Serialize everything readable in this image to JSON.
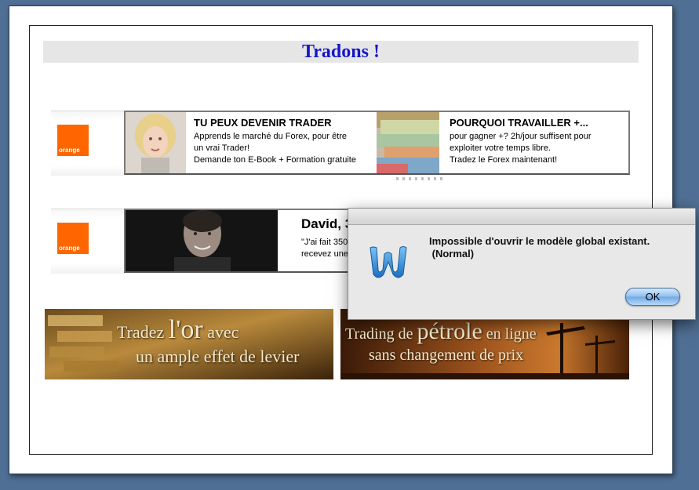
{
  "document": {
    "title": "Tradons !"
  },
  "ads": {
    "row1": {
      "logo_label": "orange",
      "ad1": {
        "heading": "TU PEUX DEVENIR TRADER",
        "lines": [
          "Apprends le marché du Forex, pour être",
          "un vrai Trader!",
          "Demande ton E-Book + Formation gratuite"
        ]
      },
      "ad2": {
        "heading": "POURQUOI TRAVAILLER +...",
        "lines": [
          "pour gagner +? 2h/jour suffisent pour",
          "exploiter votre temps libre.",
          "Tradez le Forex maintenant!"
        ]
      }
    },
    "row2": {
      "logo_label": "orange",
      "heading": "David, 3",
      "lines": [
        "\"J'ai fait 350",
        "recevez une"
      ]
    }
  },
  "banners": {
    "gold": {
      "prefix": "Tradez",
      "big": "l'or",
      "suffix": "avec",
      "line2": "un ample effet de levier"
    },
    "oil": {
      "prefix": "Trading de",
      "big": "pétrole",
      "suffix": "en ligne",
      "line2": "sans changement de prix"
    }
  },
  "dialog": {
    "message_line1": "Impossible d'ouvrir le modèle global existant.",
    "message_line2": " (Normal)",
    "ok_label": "OK",
    "icon": "word-icon"
  },
  "colors": {
    "background": "#4f6f94",
    "title_text": "#1515cc",
    "orange_brand": "#ff6600",
    "ok_button": "#8ebeed"
  }
}
